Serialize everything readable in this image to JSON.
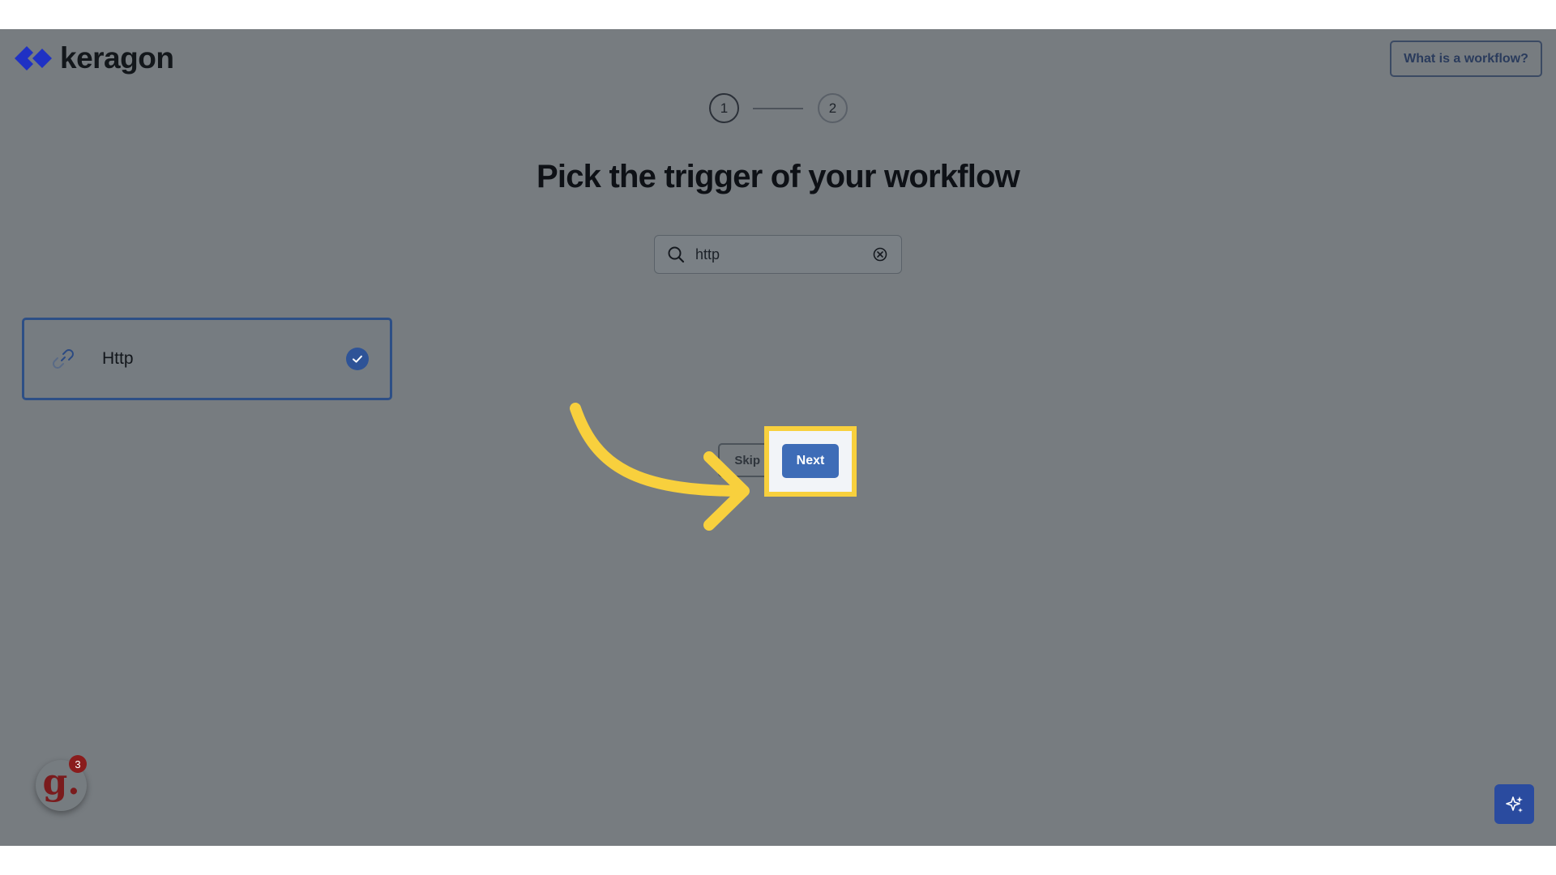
{
  "brand": {
    "name": "keragon",
    "logo_color": "#1f31c4"
  },
  "header": {
    "help_button_label": "What is a workflow?"
  },
  "stepper": {
    "steps": [
      "1",
      "2"
    ],
    "current": 1
  },
  "page": {
    "title": "Pick the trigger of your workflow"
  },
  "search": {
    "value": "http",
    "icon": "search-icon",
    "clear_icon": "clear-circle-icon"
  },
  "results": [
    {
      "label": "Http",
      "icon": "link-icon",
      "selected": true
    }
  ],
  "actions": {
    "skip_label": "Skip",
    "next_label": "Next"
  },
  "annotation": {
    "highlight_color": "#f8d03d",
    "arrow_color": "#f8d03d"
  },
  "widgets": {
    "g_letter": "g.",
    "g_badge_count": "3",
    "ai_icon": "sparkle-icon"
  },
  "colors": {
    "overlay": "#767c81",
    "accent": "#3e6cb7",
    "selected_border": "#2d4f86"
  }
}
